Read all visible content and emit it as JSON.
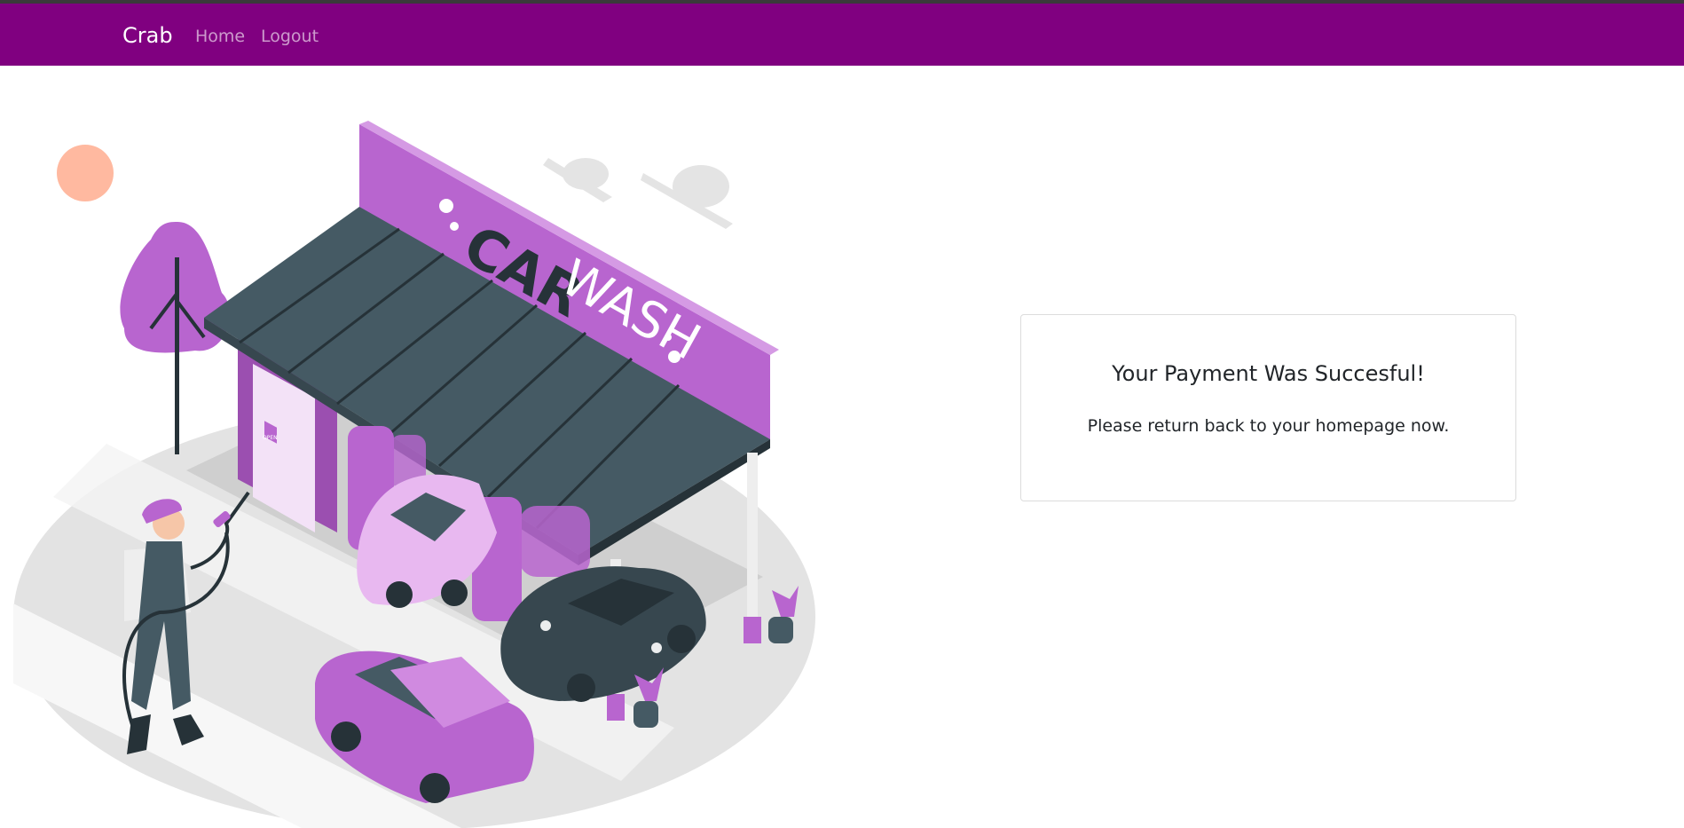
{
  "navbar": {
    "brand": "Crab",
    "links": [
      "Home",
      "Logout"
    ],
    "color": "#800080"
  },
  "illustration": {
    "sign_text_bold": "CAR",
    "sign_text_light": "WASH",
    "door_sign": "OPEN",
    "accent_color": "#B865CF"
  },
  "card": {
    "title": "Your Payment Was Succesful!",
    "message": "Please return back to your homepage now."
  }
}
